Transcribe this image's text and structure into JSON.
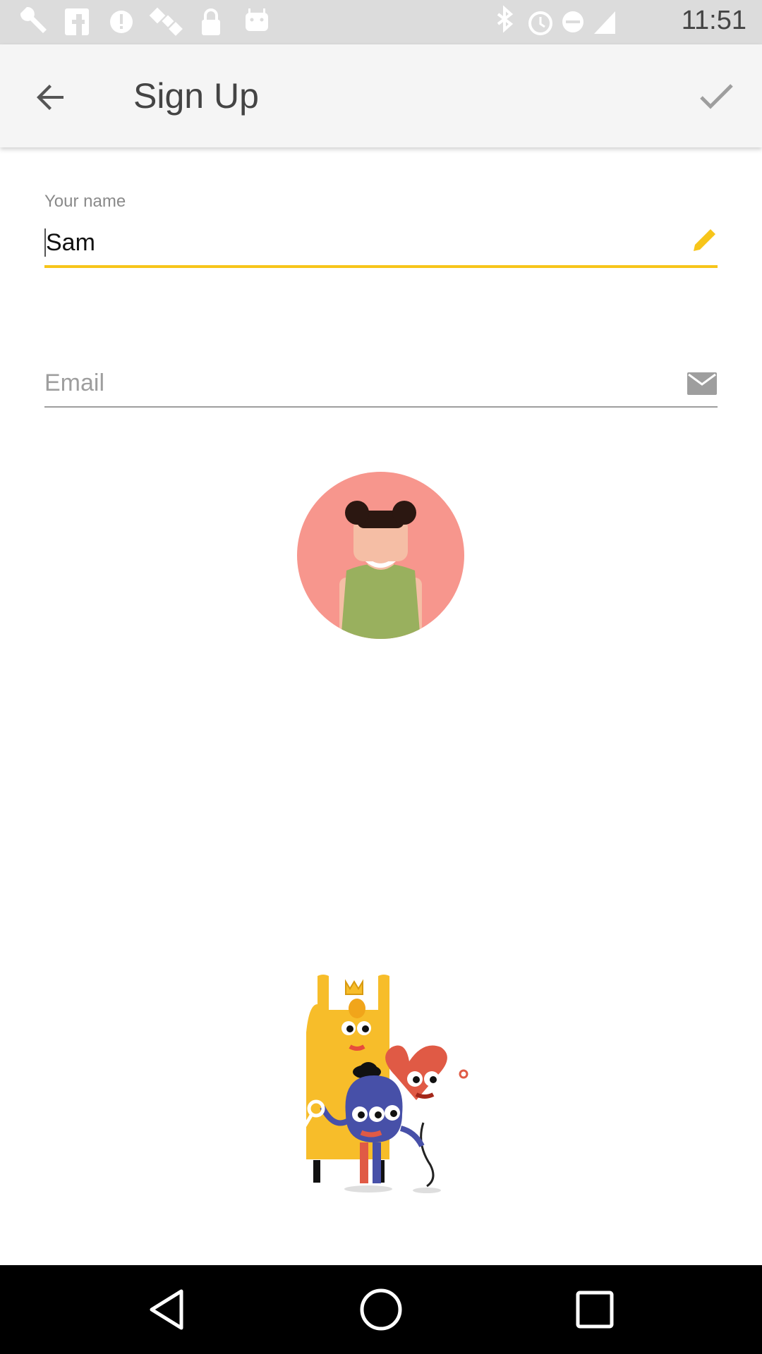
{
  "status_bar": {
    "time": "11:51",
    "left_icons": [
      "wrench-icon",
      "facebook-icon",
      "alert-icon",
      "satellite-icon",
      "lock-icon",
      "android-icon"
    ],
    "right_icons": [
      "bluetooth-icon",
      "alarm-icon",
      "do-not-disturb-icon",
      "cellular-icon"
    ]
  },
  "app_bar": {
    "title": "Sign Up"
  },
  "form": {
    "name_label": "Your name",
    "name_value": "Sam",
    "email_placeholder": "Email"
  },
  "colors": {
    "accent": "#f7c51a",
    "avatar_bg": "#f7968d",
    "shirt": "#99b05e"
  }
}
